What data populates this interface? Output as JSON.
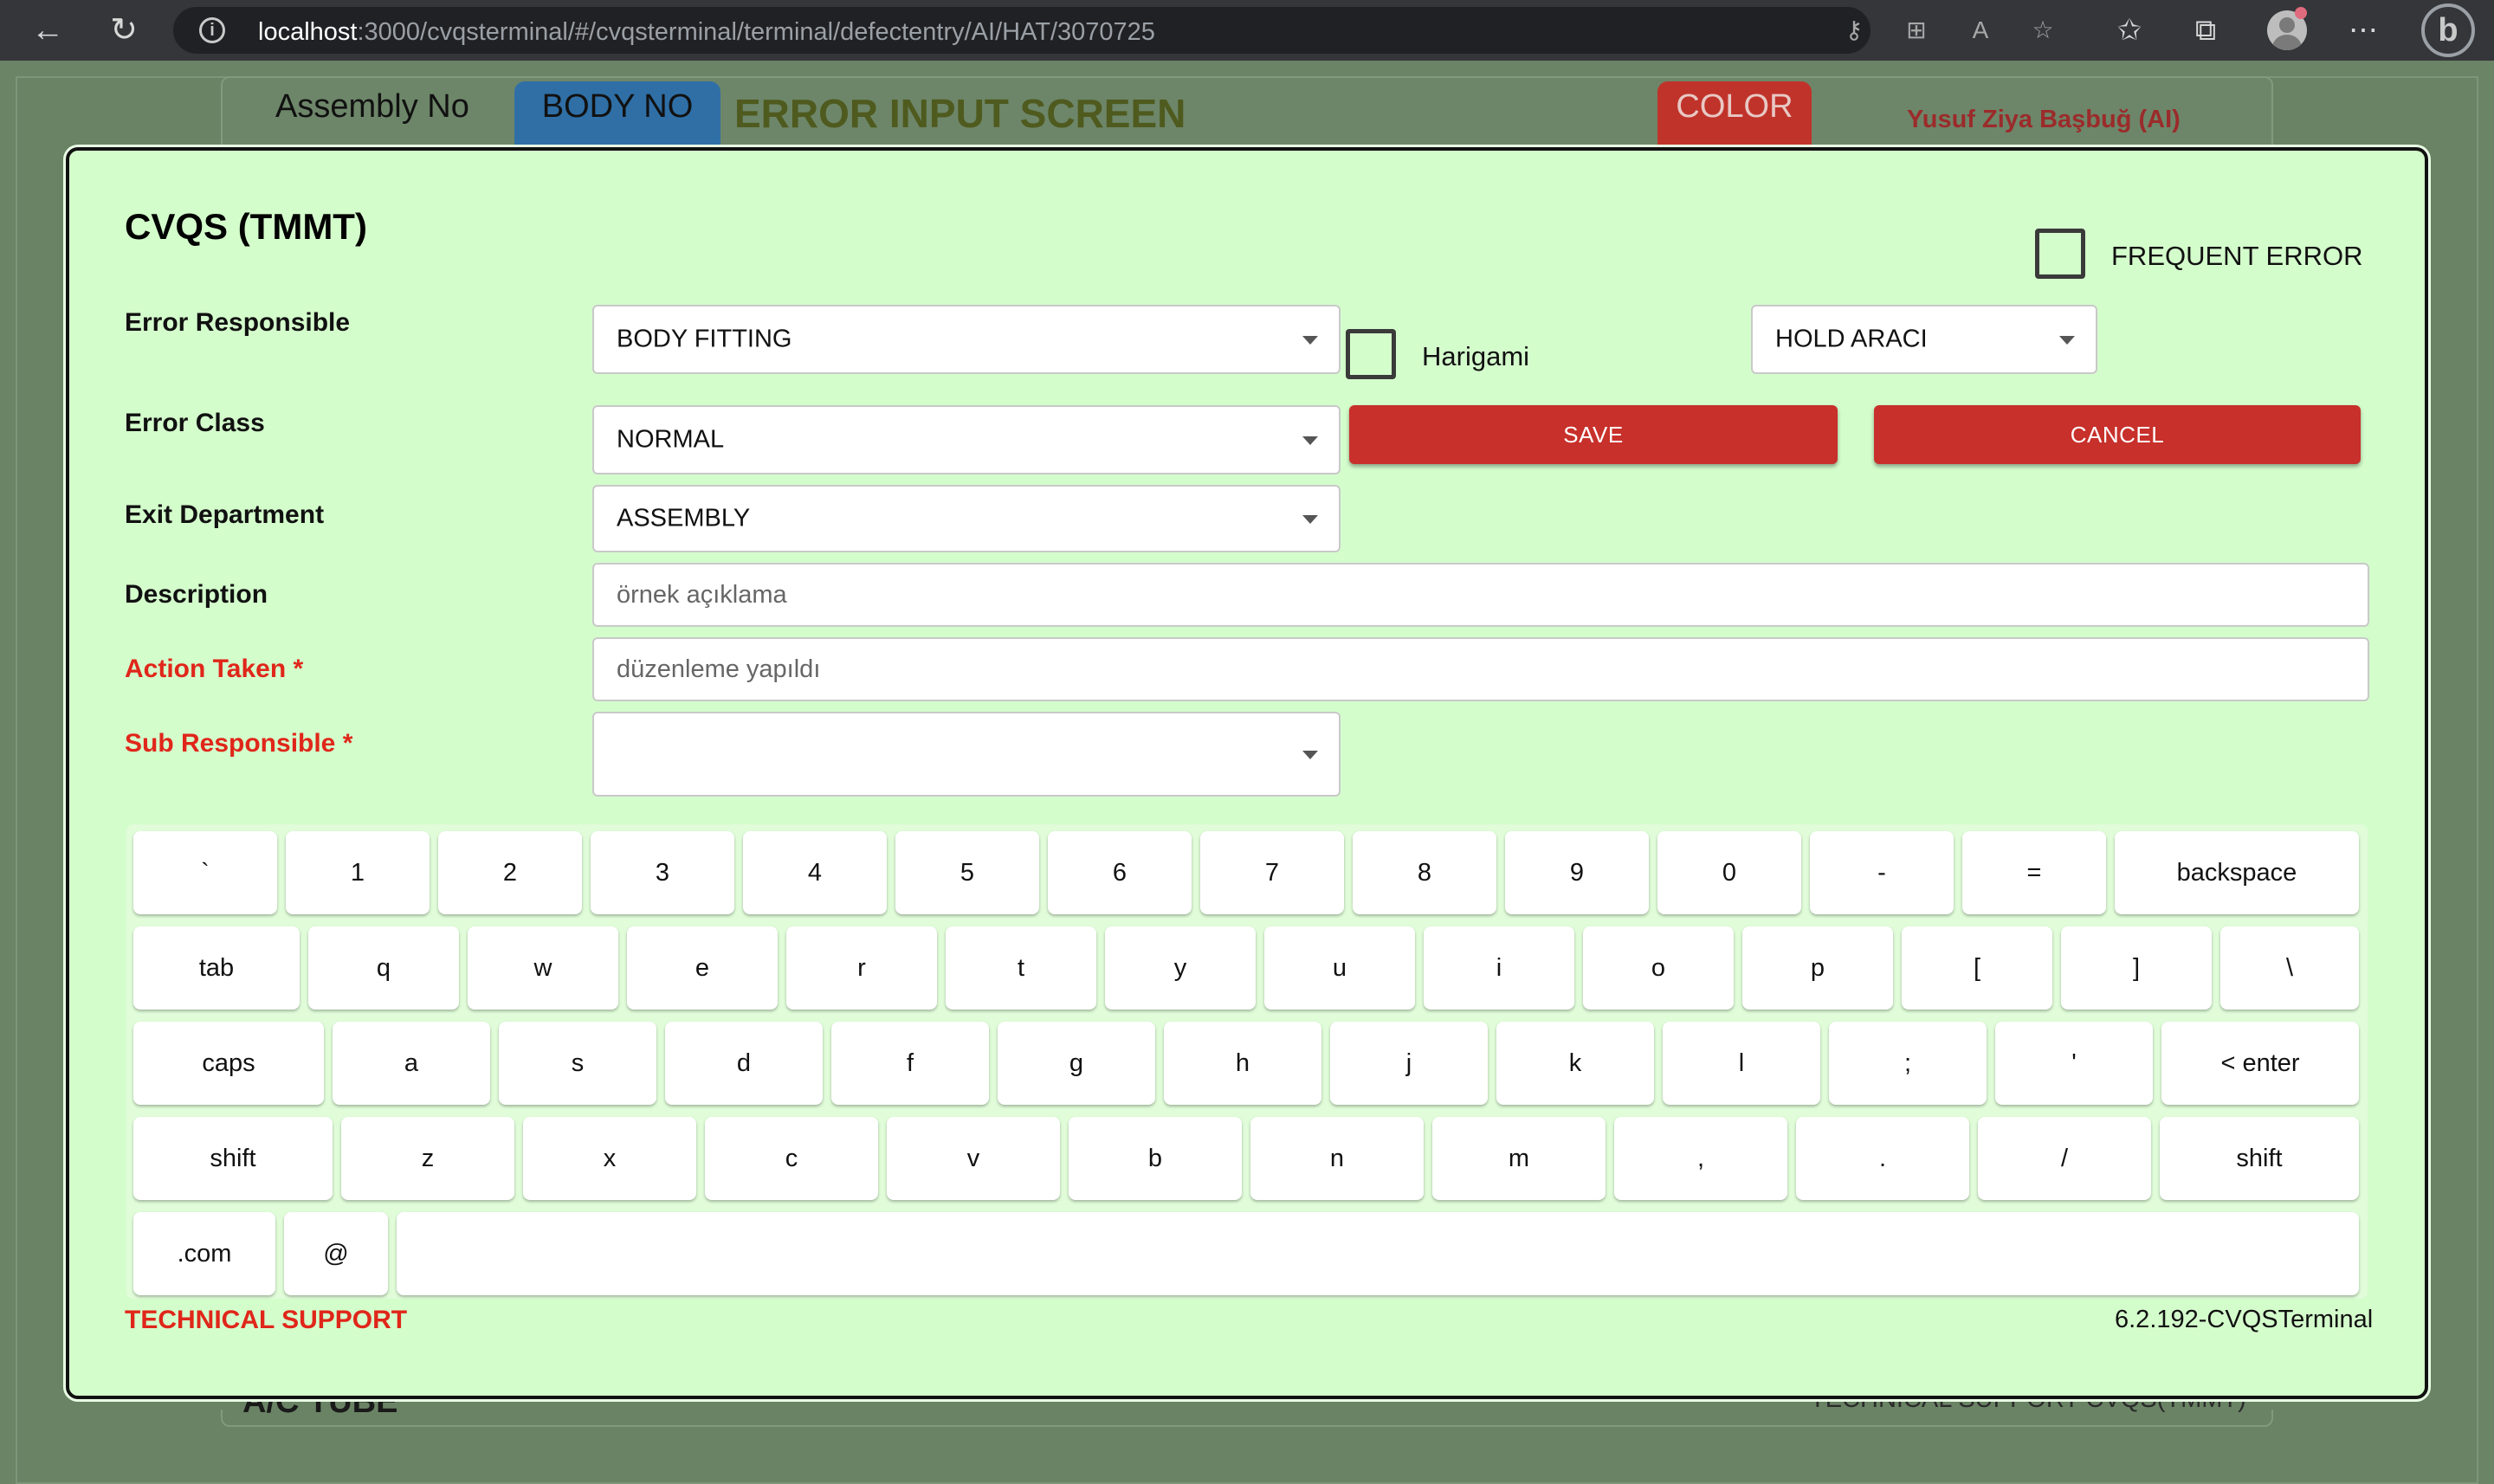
{
  "browser": {
    "url_host": "localhost",
    "url_path": ":3000/cvqsterminal/#/cvqsterminal/terminal/defectentry/AI/HAT/3070725"
  },
  "background": {
    "assembly_label": "Assembly No",
    "body_no_label": "BODY NO",
    "title": "ERROR INPUT SCREEN",
    "color_label": "COLOR",
    "user": "Yusuf Ziya Başbuğ (AI)",
    "footer_left": "A/C TUBE",
    "footer_right": "TECHNICAL SUPPORT  CVQS(TMMT)"
  },
  "modal": {
    "title": "CVQS (TMMT)",
    "frequent_error_label": "FREQUENT ERROR",
    "frequent_error_checked": false,
    "harigami_label": "Harigami",
    "harigami_checked": false,
    "labels": {
      "error_responsible": "Error Responsible",
      "error_class": "Error Class",
      "exit_department": "Exit Department",
      "description": "Description",
      "action_taken": "Action Taken *",
      "sub_responsible": "Sub Responsible *"
    },
    "values": {
      "error_responsible": "BODY FITTING",
      "hold": "HOLD ARACI",
      "error_class": "NORMAL",
      "exit_department": "ASSEMBLY",
      "sub_responsible": ""
    },
    "placeholders": {
      "description": "örnek açıklama",
      "action_taken": "düzenleme yapıldı"
    },
    "buttons": {
      "save": "SAVE",
      "cancel": "CANCEL"
    },
    "technical_support": "TECHNICAL SUPPORT",
    "version": "6.2.192-CVQSTerminal"
  },
  "keyboard": {
    "rows": [
      [
        "`",
        "1",
        "2",
        "3",
        "4",
        "5",
        "6",
        "7",
        "8",
        "9",
        "0",
        "-",
        "=",
        "backspace"
      ],
      [
        "tab",
        "q",
        "w",
        "e",
        "r",
        "t",
        "y",
        "u",
        "i",
        "o",
        "p",
        "[",
        "]",
        "\\"
      ],
      [
        "caps",
        "a",
        "s",
        "d",
        "f",
        "g",
        "h",
        "j",
        "k",
        "l",
        ";",
        "'",
        "< enter"
      ],
      [
        "shift",
        "z",
        "x",
        "c",
        "v",
        "b",
        "n",
        "m",
        ",",
        ".",
        "/",
        "shift"
      ],
      [
        ".com",
        "@",
        ""
      ]
    ]
  }
}
